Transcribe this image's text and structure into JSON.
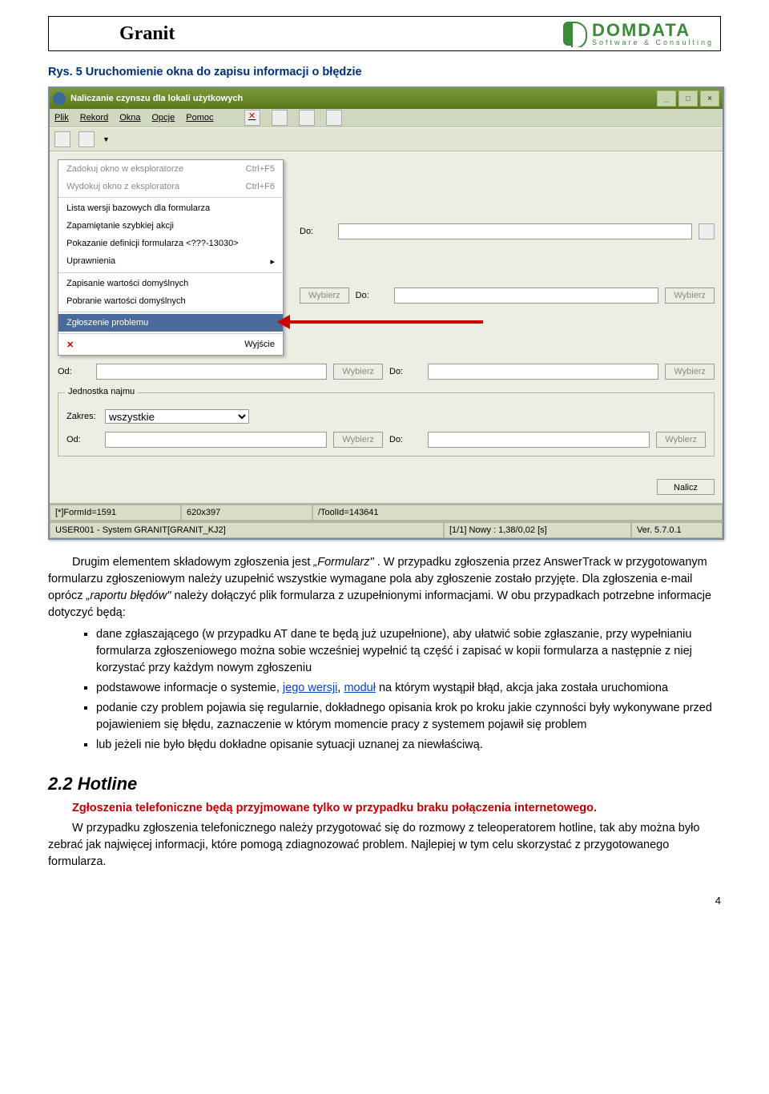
{
  "header": {
    "title": "Granit",
    "logo_name": "DOMDATA",
    "logo_sub": "Software & Consulting"
  },
  "figure_caption": "Rys. 5 Uruchomienie okna do zapisu informacji o błędzie",
  "app": {
    "title": "Naliczanie czynszu dla lokali użytkowych",
    "menu": [
      "Plik",
      "Rekord",
      "Okna",
      "Opcje",
      "Pomoc"
    ],
    "dropdown": [
      {
        "label": "Zadokuj okno w eksploratorze",
        "short": "Ctrl+F5",
        "disabled": true
      },
      {
        "label": "Wydokuj okno z eksploratora",
        "short": "Ctrl+F6",
        "disabled": true
      },
      {
        "label": "Lista wersji bazowych dla formularza"
      },
      {
        "label": "Zapamiętanie szybkiej akcji"
      },
      {
        "label": "Pokazanie definicji formularza <???-13030>"
      },
      {
        "label": "Uprawnienia",
        "sub": true
      },
      {
        "label": "Zapisanie wartości domyślnych"
      },
      {
        "label": "Pobranie wartości domyślnych"
      },
      {
        "label": "Zgłoszenie problemu",
        "selected": true
      },
      {
        "label": "Wyjście",
        "icon": "x"
      }
    ],
    "labels": {
      "od": "Od:",
      "do": "Do:",
      "choose": "Wybierz",
      "group": "Jednostka najmu",
      "zakres": "Zakres:",
      "zakres_val": "wszystkie",
      "nalicz": "Nalicz"
    },
    "status": {
      "a": "[*]FormId=1591",
      "b": "620x397",
      "c": "/ToolId=143641",
      "d": "USER001 - System GRANIT[GRANIT_KJ2]",
      "e": "[1/1] Nowy : 1,38/0,02 [s]",
      "f": "Ver. 5.7.0.1"
    }
  },
  "body_p1a": "Drugim elementem składowym zgłoszenia jest ",
  "body_p1b": "„Formularz\"",
  "body_p1c": " . W przypadku zgłoszenia przez AnswerTrack w przygotowanym formularzu zgłoszeniowym należy uzupełnić wszystkie wymagane pola aby zgłoszenie zostało przyjęte. Dla zgłoszenia e-mail oprócz ",
  "body_p1d": "„raportu błędów\"",
  "body_p1e": " należy dołączyć plik formularza z uzupełnionymi informacjami. W obu przypadkach potrzebne informacje dotyczyć będą:",
  "bullets": [
    {
      "t": "dane zgłaszającego (w przypadku AT dane te będą już uzupełnione), aby ułatwić sobie zgłaszanie, przy wypełnianiu formularza zgłoszeniowego można sobie wcześniej wypełnić tą część i zapisać w kopii formularza a następnie z niej korzystać przy każdym nowym zgłoszeniu"
    },
    {
      "pre": "podstawowe informacje o systemie, ",
      "l1": "jego wersji",
      "mid": ", ",
      "l2": "moduł",
      "post": " na którym wystąpił błąd, akcja jaka została uruchomiona"
    },
    {
      "t": "podanie czy problem pojawia się regularnie, dokładnego opisania krok po kroku jakie czynności były wykonywane przed pojawieniem się błędu, zaznaczenie w którym momencie pracy z systemem pojawił się problem"
    },
    {
      "t": "lub jeżeli nie było błędu dokładne opisanie sytuacji uznanej za niewłaściwą."
    }
  ],
  "section_title": "2.2  Hotline",
  "notice": "Zgłoszenia telefoniczne będą przyjmowane tylko w przypadku braku połączenia internetowego.",
  "p2": "W przypadku zgłoszenia telefonicznego należy przygotować się do rozmowy z teleoperatorem hotline, tak aby można było zebrać jak najwięcej informacji, które pomogą zdiagnozować problem. Najlepiej w tym celu skorzystać z przygotowanego formularza.",
  "page_number": "4"
}
